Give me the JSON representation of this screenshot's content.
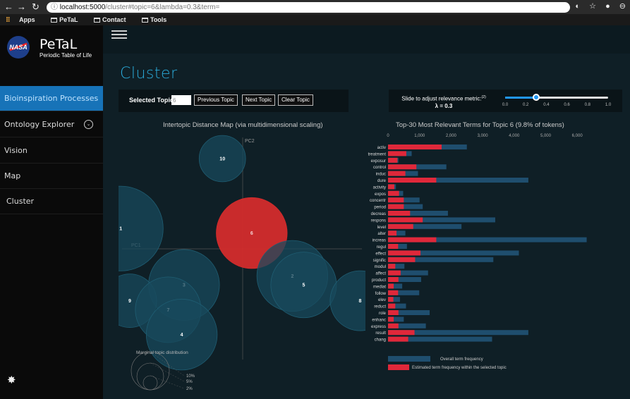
{
  "browser": {
    "url_host": "localhost:5000",
    "url_rest": "/cluster#topic=6&lambda=0.3&term=",
    "bookmarks": [
      "Apps",
      "PeTaL",
      "Contact",
      "Tools"
    ]
  },
  "sidebar": {
    "logo_text": "NASA",
    "title": "PeTaL",
    "subtitle": "Periodic Table of Life",
    "items": [
      {
        "label": "Bioinspiration Processes",
        "active": true
      },
      {
        "label": "Ontology Explorer",
        "active": false
      },
      {
        "label": "Vision",
        "active": false
      },
      {
        "label": "Map",
        "active": false
      },
      {
        "label": "Cluster",
        "active": false
      }
    ]
  },
  "page": {
    "title": "Cluster"
  },
  "controls": {
    "selected_topic_label": "Selected Topic:",
    "selected_topic_value": "6",
    "prev_label": "Previous Topic",
    "next_label": "Next Topic",
    "clear_label": "Clear Topic"
  },
  "slider": {
    "label": "Slide to adjust relevance metric:",
    "footnote": "(2)",
    "value_label": "λ = 0.3",
    "value": 0.3,
    "ticks": [
      "0.0",
      "0.2",
      "0.4",
      "0.6",
      "0.8",
      "1.0"
    ]
  },
  "chart_data": [
    {
      "type": "scatter",
      "title": "Intertopic Distance Map (via multidimensional scaling)",
      "xlabel": "PC1",
      "ylabel": "PC2",
      "selected_topic": 6,
      "topics": [
        {
          "id": 10,
          "x": -0.09,
          "y": 0.4,
          "size": 0.03
        },
        {
          "id": 1,
          "x": -0.54,
          "y": 0.09,
          "size": 0.1
        },
        {
          "id": 6,
          "x": 0.04,
          "y": 0.07,
          "size": 0.07
        },
        {
          "id": 3,
          "x": -0.26,
          "y": -0.16,
          "size": 0.07
        },
        {
          "id": 2,
          "x": 0.22,
          "y": -0.12,
          "size": 0.07
        },
        {
          "id": 5,
          "x": 0.27,
          "y": -0.16,
          "size": 0.06
        },
        {
          "id": 8,
          "x": 0.52,
          "y": -0.23,
          "size": 0.05
        },
        {
          "id": 9,
          "x": -0.5,
          "y": -0.23,
          "size": 0.04
        },
        {
          "id": 7,
          "x": -0.33,
          "y": -0.27,
          "size": 0.06
        },
        {
          "id": 4,
          "x": -0.27,
          "y": -0.38,
          "size": 0.07
        }
      ],
      "marginal": {
        "title": "Marginal topic distribution",
        "labels": [
          "2%",
          "5%",
          "10%"
        ]
      }
    },
    {
      "type": "bar",
      "title": "Top-30 Most Relevant Terms for Topic 6 (9.8% of tokens)",
      "xlim": [
        0,
        6600
      ],
      "ticks": [
        0,
        1000,
        2000,
        3000,
        4000,
        5000,
        6000
      ],
      "tick_labels": [
        "0",
        "1,000",
        "2,000",
        "3,000",
        "4,000",
        "5,000",
        "6,000"
      ],
      "legend": [
        "Overall term frequency",
        "Estimated term frequency within the selected topic"
      ],
      "colors": {
        "overall": "#1f4e6e",
        "topic": "#e0283a"
      },
      "terms": [
        {
          "term": "activ",
          "overall": 2500,
          "topic": 1700
        },
        {
          "term": "treatment",
          "overall": 750,
          "topic": 580
        },
        {
          "term": "exposur",
          "overall": 330,
          "topic": 300
        },
        {
          "term": "control",
          "overall": 1850,
          "topic": 900
        },
        {
          "term": "induc",
          "overall": 950,
          "topic": 550
        },
        {
          "term": "dure",
          "overall": 4450,
          "topic": 1530
        },
        {
          "term": "activity",
          "overall": 250,
          "topic": 200
        },
        {
          "term": "expos",
          "overall": 480,
          "topic": 350
        },
        {
          "term": "concentr",
          "overall": 1000,
          "topic": 500
        },
        {
          "term": "period",
          "overall": 1100,
          "topic": 500
        },
        {
          "term": "decreas",
          "overall": 1900,
          "topic": 700
        },
        {
          "term": "respons",
          "overall": 3400,
          "topic": 1100
        },
        {
          "term": "level",
          "overall": 2330,
          "topic": 800
        },
        {
          "term": "alter",
          "overall": 550,
          "topic": 270
        },
        {
          "term": "increas",
          "overall": 6300,
          "topic": 1530
        },
        {
          "term": "regul",
          "overall": 600,
          "topic": 320
        },
        {
          "term": "effect",
          "overall": 4150,
          "topic": 1030
        },
        {
          "term": "signific",
          "overall": 3340,
          "topic": 860
        },
        {
          "term": "modul",
          "overall": 520,
          "topic": 230
        },
        {
          "term": "affect",
          "overall": 1270,
          "topic": 400
        },
        {
          "term": "product",
          "overall": 1050,
          "topic": 330
        },
        {
          "term": "mediat",
          "overall": 450,
          "topic": 180
        },
        {
          "term": "follow",
          "overall": 990,
          "topic": 320
        },
        {
          "term": "elev",
          "overall": 380,
          "topic": 170
        },
        {
          "term": "reduct",
          "overall": 570,
          "topic": 230
        },
        {
          "term": "role",
          "overall": 1320,
          "topic": 330
        },
        {
          "term": "enhanc",
          "overall": 500,
          "topic": 180
        },
        {
          "term": "express",
          "overall": 1200,
          "topic": 330
        },
        {
          "term": "result",
          "overall": 4450,
          "topic": 840
        },
        {
          "term": "chang",
          "overall": 3300,
          "topic": 640
        }
      ]
    }
  ]
}
